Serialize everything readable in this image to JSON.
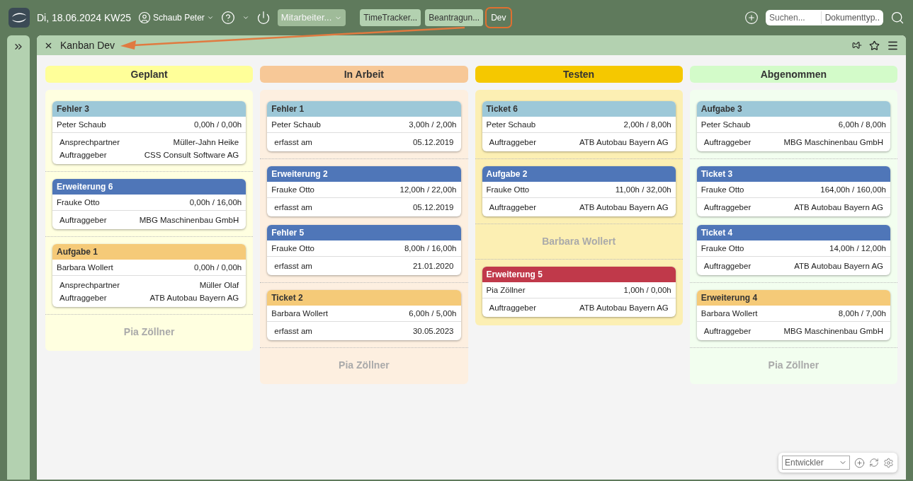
{
  "topbar": {
    "date": "Di, 18.06.2024 KW25",
    "user": "Schaub Peter",
    "employee_select": "Mitarbeiter...",
    "tabs": [
      {
        "label": "TimeTracker...",
        "selected": false,
        "highlighted": false
      },
      {
        "label": "Beantragun...",
        "selected": false,
        "highlighted": false
      },
      {
        "label": "Dev",
        "selected": true,
        "highlighted": true
      }
    ],
    "search": {
      "placeholder": "Suchen...",
      "doctype": "Dokumenttyp.."
    }
  },
  "panel": {
    "title": "Kanban Dev"
  },
  "columns": [
    {
      "title": "Geplant",
      "color": "#ffff99",
      "items": [
        {
          "kind": "card",
          "title": "Fehler 3",
          "color": "#9dc8d8",
          "person": "Peter Schaub",
          "hours": "0,00h / 0,00h",
          "details": [
            {
              "label": "Ansprechpartner",
              "value": "Müller-Jahn Heike"
            },
            {
              "label": "Auftraggeber",
              "value": "CSS Consult Software AG"
            }
          ]
        },
        {
          "kind": "card",
          "title": "Erweiterung 6",
          "color": "#4f76b8",
          "person": "Frauke Otto",
          "hours": "0,00h / 16,00h",
          "details": [
            {
              "label": "Auftraggeber",
              "value": "MBG Maschinenbau GmbH"
            }
          ]
        },
        {
          "kind": "card",
          "title": "Aufgabe 1",
          "color": "#f5ca78",
          "person": "Barbara Wollert",
          "hours": "0,00h / 0,00h",
          "details": [
            {
              "label": "Ansprechpartner",
              "value": "Müller Olaf"
            },
            {
              "label": "Auftraggeber",
              "value": "ATB Autobau Bayern AG"
            }
          ]
        },
        {
          "kind": "lane",
          "title": "Pia Zöllner"
        }
      ]
    },
    {
      "title": "In Arbeit",
      "color": "#f7c897",
      "items": [
        {
          "kind": "card",
          "title": "Fehler 1",
          "color": "#9dc8d8",
          "person": "Peter Schaub",
          "hours": "3,00h / 2,00h",
          "details": [
            {
              "label": "erfasst am",
              "value": "05.12.2019"
            }
          ]
        },
        {
          "kind": "card",
          "title": "Erweiterung 2",
          "color": "#4f76b8",
          "person": "Frauke Otto",
          "hours": "12,00h / 22,00h",
          "details": [
            {
              "label": "erfasst am",
              "value": "05.12.2019"
            }
          ]
        },
        {
          "kind": "card",
          "title": "Fehler 5",
          "color": "#4f76b8",
          "person": "Frauke Otto",
          "hours": "8,00h / 16,00h",
          "details": [
            {
              "label": "erfasst am",
              "value": "21.01.2020"
            }
          ]
        },
        {
          "kind": "card",
          "title": "Ticket 2",
          "color": "#f5ca78",
          "person": "Barbara Wollert",
          "hours": "6,00h / 5,00h",
          "details": [
            {
              "label": "erfasst am",
              "value": "30.05.2023"
            }
          ]
        },
        {
          "kind": "lane",
          "title": "Pia Zöllner"
        }
      ]
    },
    {
      "title": "Testen",
      "color": "#f5c800",
      "items": [
        {
          "kind": "card",
          "title": "Ticket 6",
          "color": "#9dc8d8",
          "person": "Peter Schaub",
          "hours": "2,00h / 8,00h",
          "details": [
            {
              "label": "Auftraggeber",
              "value": "ATB Autobau Bayern AG"
            }
          ]
        },
        {
          "kind": "card",
          "title": "Aufgabe 2",
          "color": "#4f76b8",
          "person": "Frauke Otto",
          "hours": "11,00h / 32,00h",
          "details": [
            {
              "label": "Auftraggeber",
              "value": "ATB Autobau Bayern AG"
            }
          ]
        },
        {
          "kind": "lane",
          "title": "Barbara Wollert"
        },
        {
          "kind": "card",
          "title": "Erweiterung 5",
          "color": "#c0394a",
          "person": "Pia Zöllner",
          "hours": "1,00h / 0,00h",
          "details": [
            {
              "label": "Auftraggeber",
              "value": "ATB Autobau Bayern AG"
            }
          ]
        }
      ]
    },
    {
      "title": "Abgenommen",
      "color": "#d3fbc9",
      "items": [
        {
          "kind": "card",
          "title": "Aufgabe 3",
          "color": "#9dc8d8",
          "person": "Peter Schaub",
          "hours": "6,00h / 8,00h",
          "details": [
            {
              "label": "Auftraggeber",
              "value": "MBG Maschinenbau GmbH"
            }
          ]
        },
        {
          "kind": "card",
          "title": "Ticket 3",
          "color": "#4f76b8",
          "person": "Frauke Otto",
          "hours": "164,00h / 160,00h",
          "details": [
            {
              "label": "Auftraggeber",
              "value": "ATB Autobau Bayern AG"
            }
          ]
        },
        {
          "kind": "card",
          "title": "Ticket 4",
          "color": "#4f76b8",
          "person": "Frauke Otto",
          "hours": "14,00h / 12,00h",
          "details": [
            {
              "label": "Auftraggeber",
              "value": "ATB Autobau Bayern AG"
            }
          ]
        },
        {
          "kind": "card",
          "title": "Erweiterung 4",
          "color": "#f5ca78",
          "person": "Barbara Wollert",
          "hours": "8,00h / 7,00h",
          "details": [
            {
              "label": "Auftraggeber",
              "value": "MBG Maschinenbau GmbH"
            }
          ]
        },
        {
          "kind": "lane",
          "title": "Pia Zöllner"
        }
      ]
    }
  ],
  "footer": {
    "role_select": "Entwickler"
  }
}
